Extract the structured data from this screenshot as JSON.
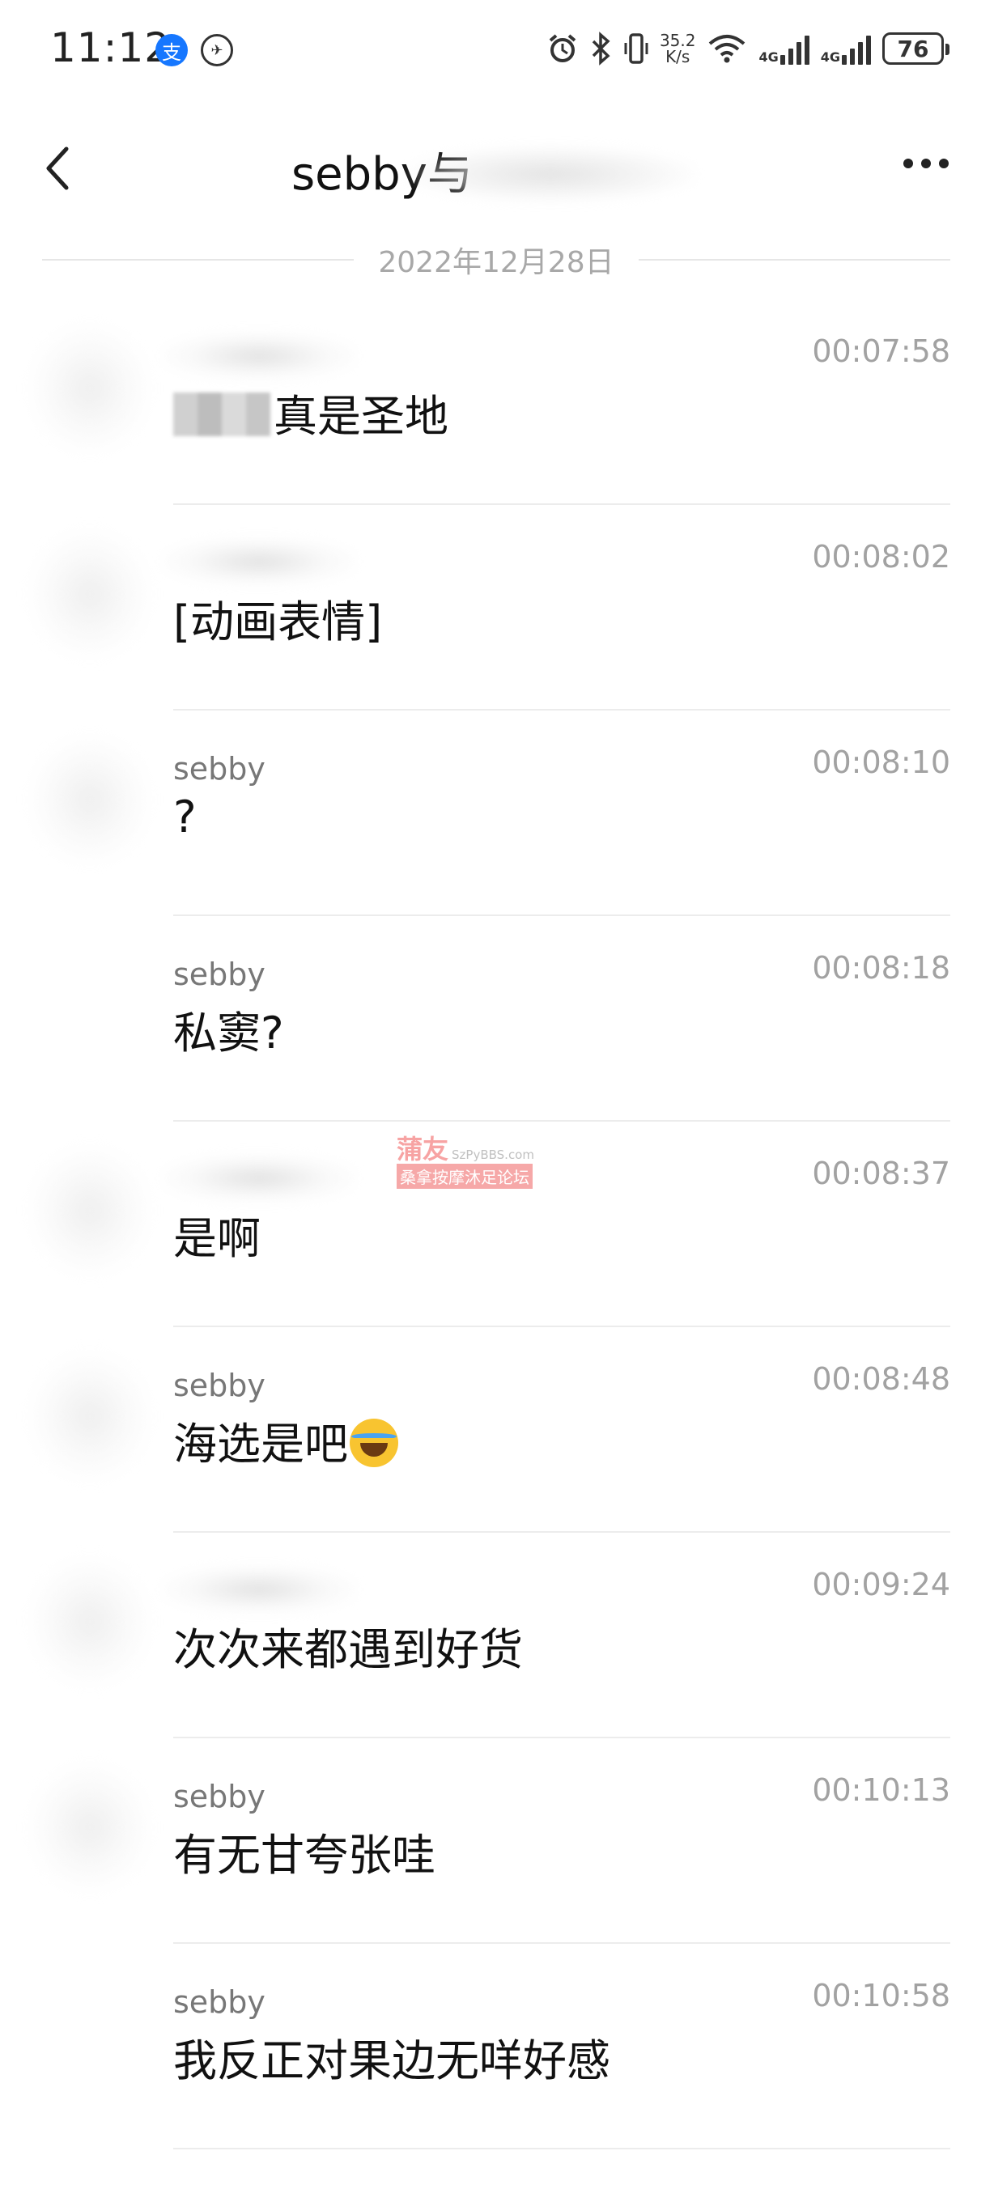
{
  "status_bar": {
    "time": "11:12",
    "speed_value": "35.2",
    "speed_unit": "K/s",
    "network_1": "4G",
    "network_2": "4G",
    "battery": "76"
  },
  "header": {
    "title": "sebby与"
  },
  "date_divider": "2022年12月28日",
  "messages": [
    {
      "sender": "",
      "time": "00:07:58",
      "text": "真是圣地"
    },
    {
      "sender": "",
      "time": "00:08:02",
      "text": "[动画表情]"
    },
    {
      "sender": "sebby",
      "time": "00:08:10",
      "text": "?"
    },
    {
      "sender": "sebby",
      "time": "00:08:18",
      "text": "私窦?"
    },
    {
      "sender": "",
      "time": "00:08:37",
      "text": "是啊"
    },
    {
      "sender": "sebby",
      "time": "00:08:48",
      "text": "海选是吧",
      "emoji": "face-with-tears-of-joy"
    },
    {
      "sender": "",
      "time": "00:09:24",
      "text": "次次来都遇到好货"
    },
    {
      "sender": "sebby",
      "time": "00:10:13",
      "text": "有无甘夸张哇"
    },
    {
      "sender": "sebby",
      "time": "00:10:58",
      "text": "我反正对果边无咩好感"
    }
  ],
  "watermark": {
    "brand": "蒲友",
    "domain": "SzPyBBS.com",
    "subtitle": "桑拿按摩沐足论坛"
  }
}
